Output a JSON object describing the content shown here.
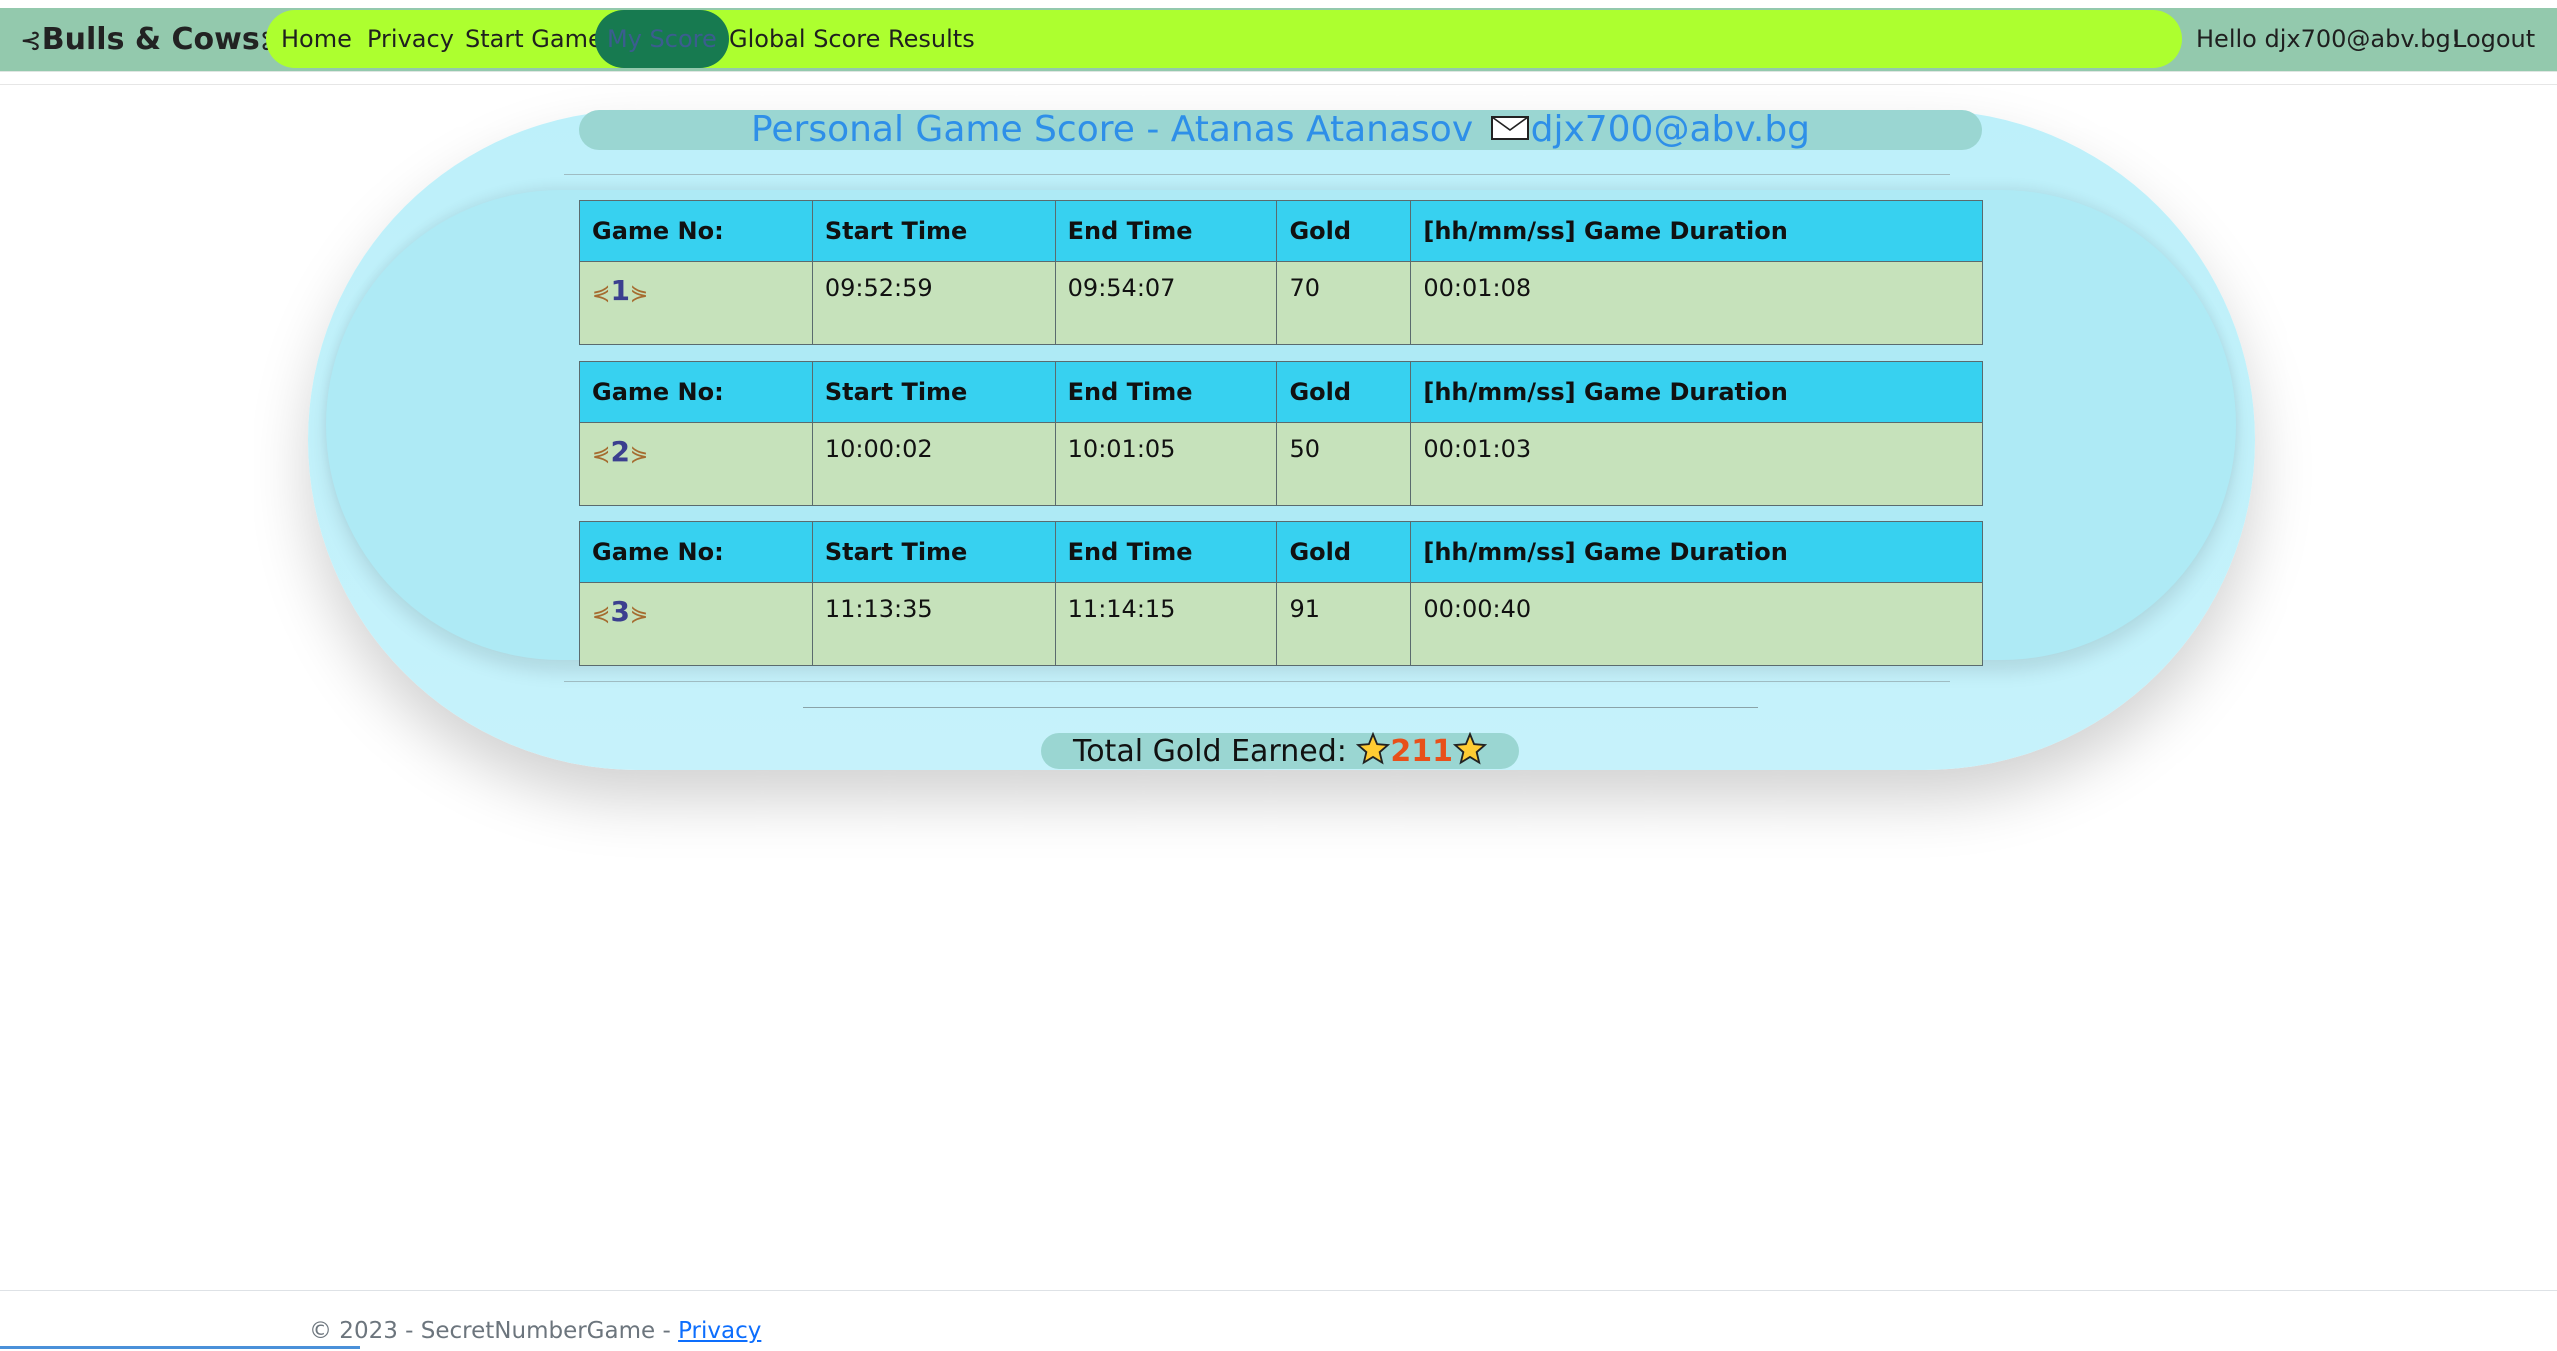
{
  "nav": {
    "brand_left_symbol": "⊰",
    "brand": "Bulls & Cows",
    "brand_right_symbol": "⊱",
    "items": [
      {
        "label": "Home"
      },
      {
        "label": "Privacy"
      },
      {
        "label": "Start Game"
      },
      {
        "label": "My Score",
        "active": true
      },
      {
        "label": "Global Score Results"
      }
    ],
    "greeting": "Hello djx700@abv.bg!",
    "logout": "Logout"
  },
  "score": {
    "title": "Personal Game Score - Atanas Atanasov",
    "email": "djx700@abv.bg",
    "headers": [
      "Game No:",
      "Start Time",
      "End Time",
      "Gold",
      "[hh/mm/ss] Game Duration"
    ],
    "games": [
      {
        "no": "1",
        "start": "09:52:59",
        "end": "09:54:07",
        "gold": "70",
        "duration": "00:01:08"
      },
      {
        "no": "2",
        "start": "10:00:02",
        "end": "10:01:05",
        "gold": "50",
        "duration": "00:01:03"
      },
      {
        "no": "3",
        "start": "11:13:35",
        "end": "11:14:15",
        "gold": "91",
        "duration": "00:00:40"
      }
    ],
    "total_label": "Total Gold Earned:",
    "total_value": "211"
  },
  "footer": {
    "copyright": "© 2023 - SecretNumberGame - ",
    "privacy_link": "Privacy"
  },
  "colors": {
    "nav_bg": "#93c9ad",
    "nav_pill": "#adff2f",
    "active_pill": "#177a50",
    "table_header": "#37d1f0",
    "table_row": "#c6e2bb",
    "title_text": "#2e8fe8",
    "gold_value": "#e8501a"
  }
}
